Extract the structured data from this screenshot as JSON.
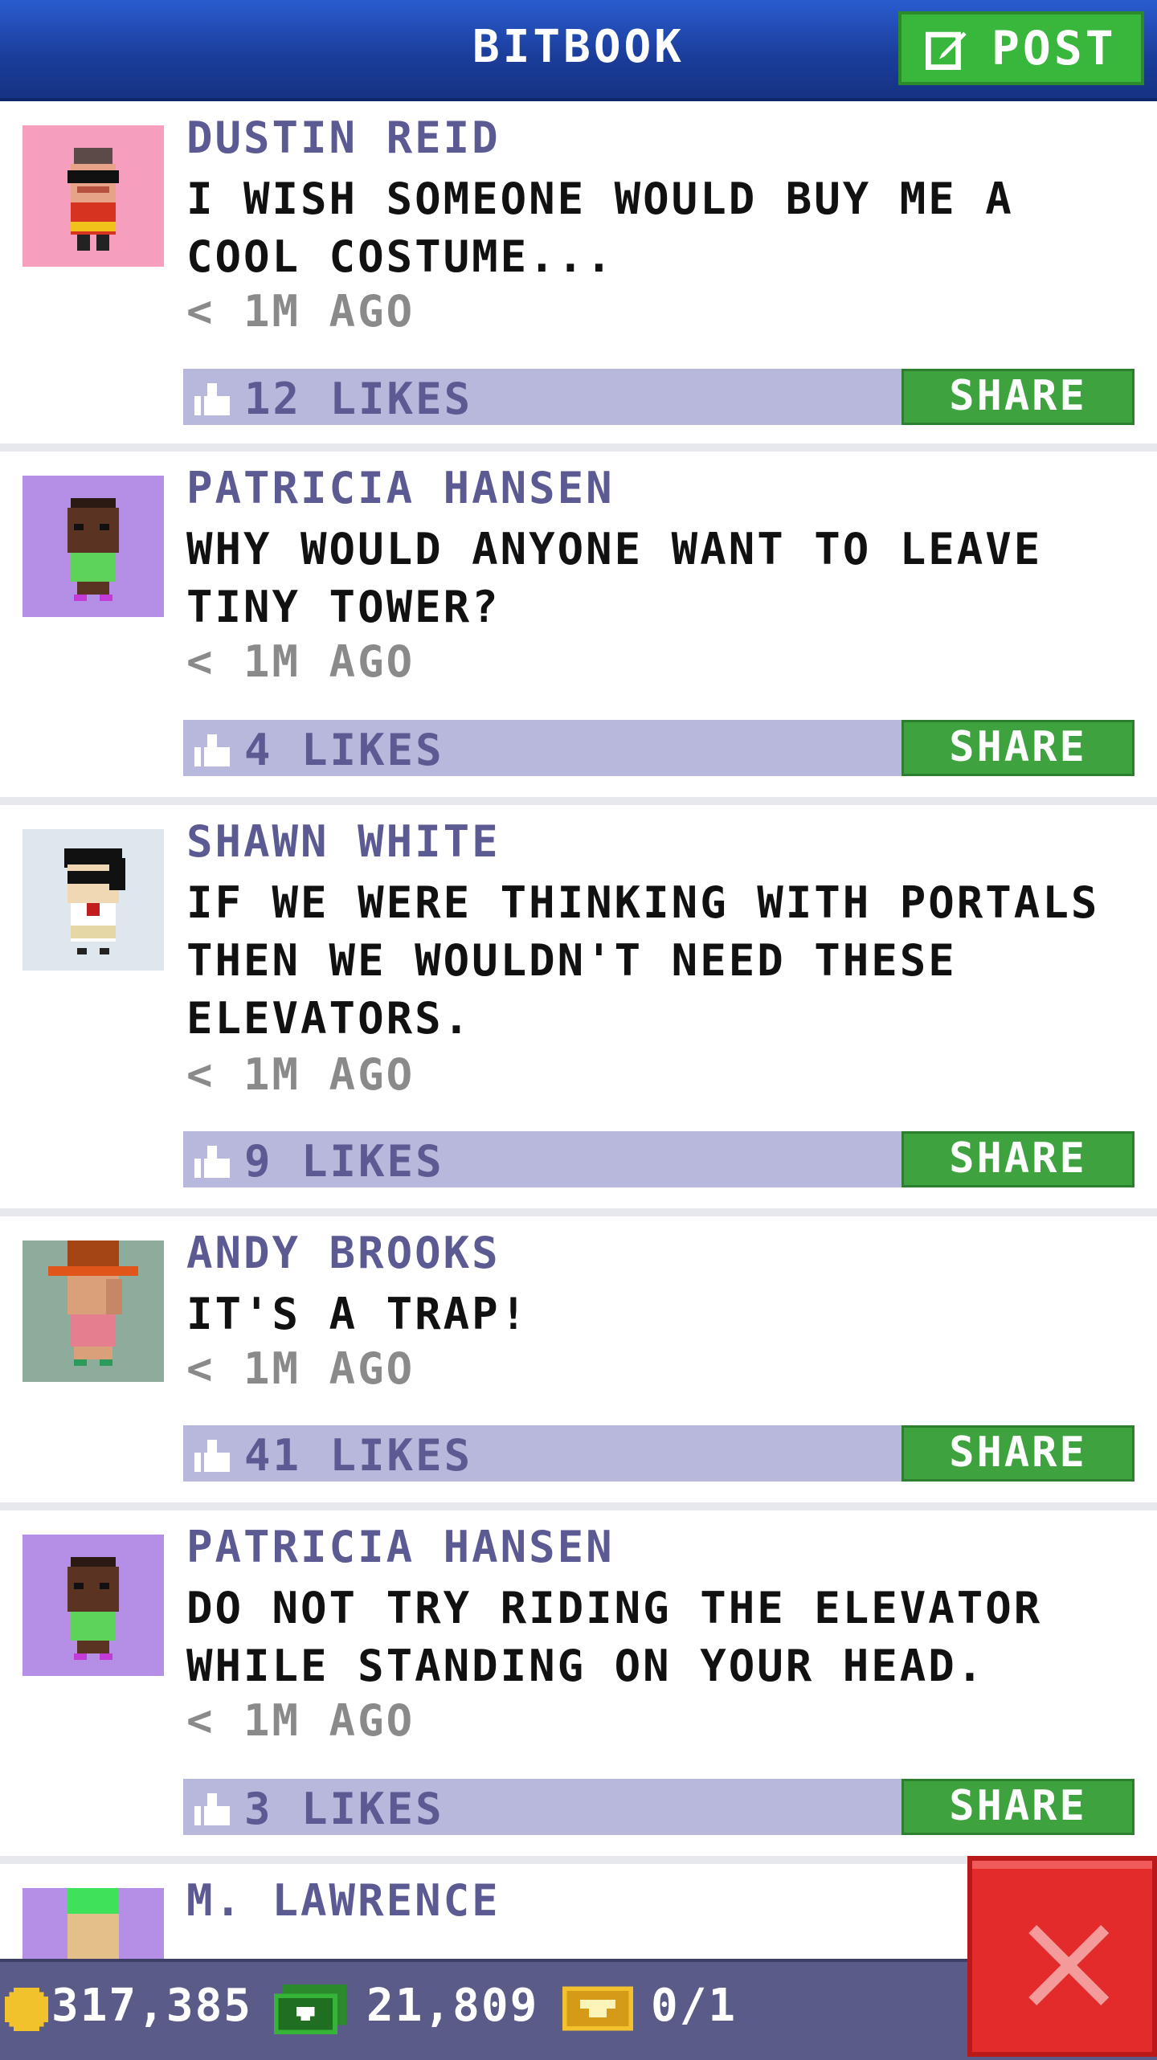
{
  "header": {
    "title": "BITBOOK",
    "post_label": "POST"
  },
  "posts": [
    {
      "name": "DUSTIN REID",
      "message": "I WISH SOMEONE WOULD BUY ME A COOL COSTUME...",
      "time": "< 1M AGO",
      "likes": "12 LIKES",
      "share": "SHARE"
    },
    {
      "name": "PATRICIA HANSEN",
      "message": "WHY WOULD ANYONE WANT TO LEAVE TINY TOWER?",
      "time": "< 1M AGO",
      "likes": "4 LIKES",
      "share": "SHARE"
    },
    {
      "name": "SHAWN WHITE",
      "message": "IF WE WERE THINKING WITH PORTALS THEN WE WOULDN'T NEED THESE ELEVATORS.",
      "time": "< 1M AGO",
      "likes": "9 LIKES",
      "share": "SHARE"
    },
    {
      "name": "ANDY BROOKS",
      "message": "IT'S A TRAP!",
      "time": "< 1M AGO",
      "likes": "41 LIKES",
      "share": "SHARE"
    },
    {
      "name": "PATRICIA HANSEN",
      "message": "DO NOT TRY RIDING THE ELEVATOR WHILE STANDING ON YOUR HEAD.",
      "time": "< 1M AGO",
      "likes": "3 LIKES",
      "share": "SHARE"
    },
    {
      "name": "M. LAWRENCE",
      "message": "",
      "time": "",
      "likes": "",
      "share": ""
    }
  ],
  "bottom": {
    "coins": "317,385",
    "bux": "21,809",
    "tickets": "0/1"
  },
  "colors": {
    "header": "#1a3c99",
    "post_green": "#39b63c",
    "name_purple": "#5c5a92",
    "likebar": "#b8b8dc",
    "close_red": "#e32b2b"
  },
  "icons": [
    "edit-icon",
    "like-icon",
    "coin-icon",
    "bux-icon",
    "ticket-icon",
    "close-icon"
  ]
}
